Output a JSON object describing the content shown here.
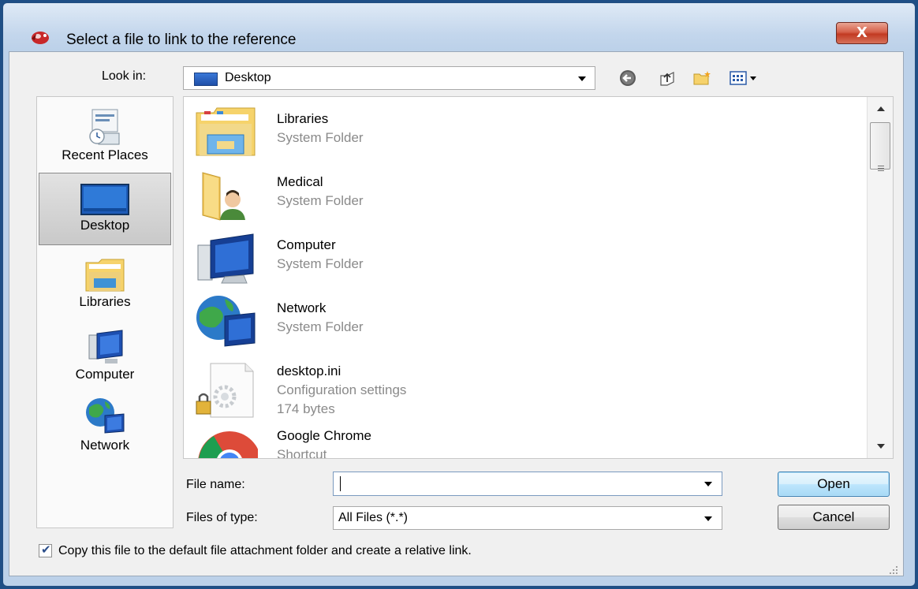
{
  "window": {
    "title": "Select a file to link to the reference",
    "close_glyph": "X"
  },
  "lookin": {
    "label": "Look in:",
    "value": "Desktop"
  },
  "toolbar": {
    "icons": [
      "back-icon",
      "up-folder-icon",
      "new-folder-icon",
      "view-menu-icon"
    ]
  },
  "places": [
    {
      "label": "Recent Places",
      "icon": "recent-places-icon"
    },
    {
      "label": "Desktop",
      "icon": "desktop-icon",
      "selected": true
    },
    {
      "label": "Libraries",
      "icon": "libraries-icon"
    },
    {
      "label": "Computer",
      "icon": "computer-icon"
    },
    {
      "label": "Network",
      "icon": "network-icon"
    }
  ],
  "files": [
    {
      "name": "Libraries",
      "desc": "System Folder",
      "icon": "libraries-folder-icon"
    },
    {
      "name": "Medical",
      "desc": "System Folder",
      "icon": "user-folder-icon"
    },
    {
      "name": "Computer",
      "desc": "System Folder",
      "icon": "computer-icon"
    },
    {
      "name": "Network",
      "desc": "System Folder",
      "icon": "network-icon"
    },
    {
      "name": "desktop.ini",
      "desc": "Configuration settings",
      "size": "174 bytes",
      "icon": "config-file-icon"
    },
    {
      "name": "Google Chrome",
      "desc": "Shortcut",
      "icon": "chrome-icon"
    }
  ],
  "filename": {
    "label": "File name:",
    "value": ""
  },
  "filetype": {
    "label": "Files of type:",
    "value": "All Files (*.*)"
  },
  "buttons": {
    "open": "Open",
    "cancel": "Cancel"
  },
  "copy_option": {
    "label": "Copy this file to the default file attachment folder and create a relative link.",
    "checked": true
  }
}
